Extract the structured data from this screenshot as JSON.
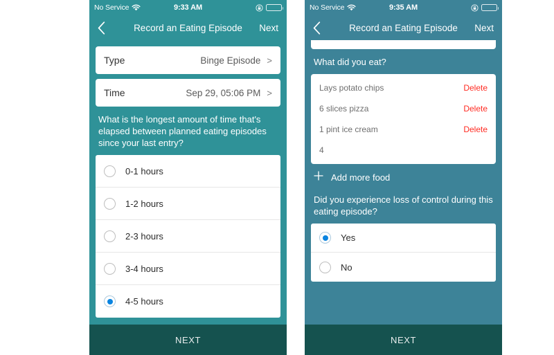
{
  "screens": [
    {
      "id": "screen-duration",
      "statusbar": {
        "carrier": "No Service",
        "time": "9:33 AM",
        "wifi_icon": "wifi-icon",
        "lock_icon": "lock-rotation-icon",
        "battery_icon": "battery-icon"
      },
      "navbar": {
        "back_icon": "chevron-left-icon",
        "title": "Record an Eating Episode",
        "next_label": "Next"
      },
      "fields": [
        {
          "label": "Type",
          "value": "Binge Episode",
          "chevron": ">"
        },
        {
          "label": "Time",
          "value": "Sep 29, 05:06 PM",
          "chevron": ">"
        }
      ],
      "question": "What is the longest amount of time that's elapsed between planned eating episodes since your last entry?",
      "options": [
        {
          "label": "0-1 hours",
          "selected": false
        },
        {
          "label": "1-2 hours",
          "selected": false
        },
        {
          "label": "2-3 hours",
          "selected": false
        },
        {
          "label": "3-4 hours",
          "selected": false
        },
        {
          "label": "4-5 hours",
          "selected": true
        }
      ],
      "footer_label": "NEXT"
    },
    {
      "id": "screen-food",
      "statusbar": {
        "carrier": "No Service",
        "time": "9:35 AM",
        "wifi_icon": "wifi-icon",
        "lock_icon": "lock-rotation-icon",
        "battery_icon": "battery-icon"
      },
      "navbar": {
        "back_icon": "chevron-left-icon",
        "title": "Record an Eating Episode",
        "next_label": "Next"
      },
      "food_question": "What did you eat?",
      "foods": [
        {
          "name": "Lays potato chips",
          "delete_label": "Delete"
        },
        {
          "name": "6 slices pizza",
          "delete_label": "Delete"
        },
        {
          "name": "1 pint ice cream",
          "delete_label": "Delete"
        },
        {
          "name": "4",
          "delete_label": ""
        }
      ],
      "add_more": {
        "icon": "plus-icon",
        "label": "Add more food"
      },
      "control_question": "Did you experience loss of control during this eating episode?",
      "control_options": [
        {
          "label": "Yes",
          "selected": true
        },
        {
          "label": "No",
          "selected": false
        }
      ],
      "footer_label": "NEXT"
    }
  ],
  "colors": {
    "teal_left": "#2f9298",
    "teal_right": "#3d8398",
    "footer": "#15524f",
    "radio_accent": "#0a84e0",
    "delete_red": "#ff2a21"
  }
}
